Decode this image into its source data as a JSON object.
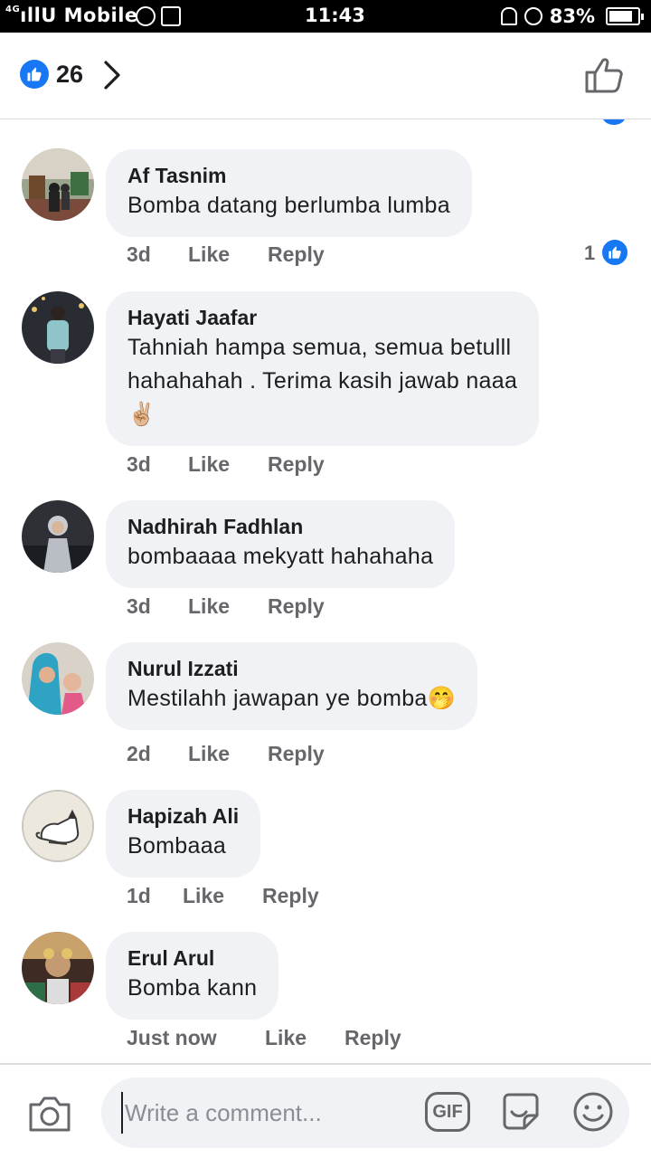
{
  "status_bar": {
    "network": "4G",
    "carrier": "U Mobile",
    "time": "11:43",
    "battery": "83%",
    "battery_level": 0.83
  },
  "header": {
    "reaction_count": "26"
  },
  "comments": [
    {
      "author": "Af Tasnim",
      "text": [
        "Bomba datang berlumba lumba"
      ],
      "time": "3d",
      "like_label": "Like",
      "reply_label": "Reply",
      "reactions": "1"
    },
    {
      "author": "Hayati Jaafar",
      "text": [
        "Tahniah hampa semua, semua betulll",
        "hahahahah . Terima kasih jawab naaa",
        "✌🏼"
      ],
      "time": "3d",
      "like_label": "Like",
      "reply_label": "Reply"
    },
    {
      "author": "Nadhirah Fadhlan",
      "text": [
        "bombaaaa mekyatt hahahaha"
      ],
      "time": "3d",
      "like_label": "Like",
      "reply_label": "Reply"
    },
    {
      "author": "Nurul Izzati",
      "text": [
        "Mestilahh jawapan ye bomba🤭"
      ],
      "time": "2d",
      "like_label": "Like",
      "reply_label": "Reply"
    },
    {
      "author": "Hapizah Ali",
      "text": [
        "Bombaaa"
      ],
      "time": "1d",
      "like_label": "Like",
      "reply_label": "Reply"
    },
    {
      "author": "Erul Arul",
      "text": [
        "Bomba kann"
      ],
      "time": "Just now",
      "like_label": "Like",
      "reply_label": "Reply"
    }
  ],
  "composer": {
    "placeholder": "Write a comment...",
    "gif_label": "GIF"
  },
  "colors": {
    "accent": "#1877f2",
    "bubble": "#f0f2f5",
    "secondary_text": "#65676b"
  }
}
